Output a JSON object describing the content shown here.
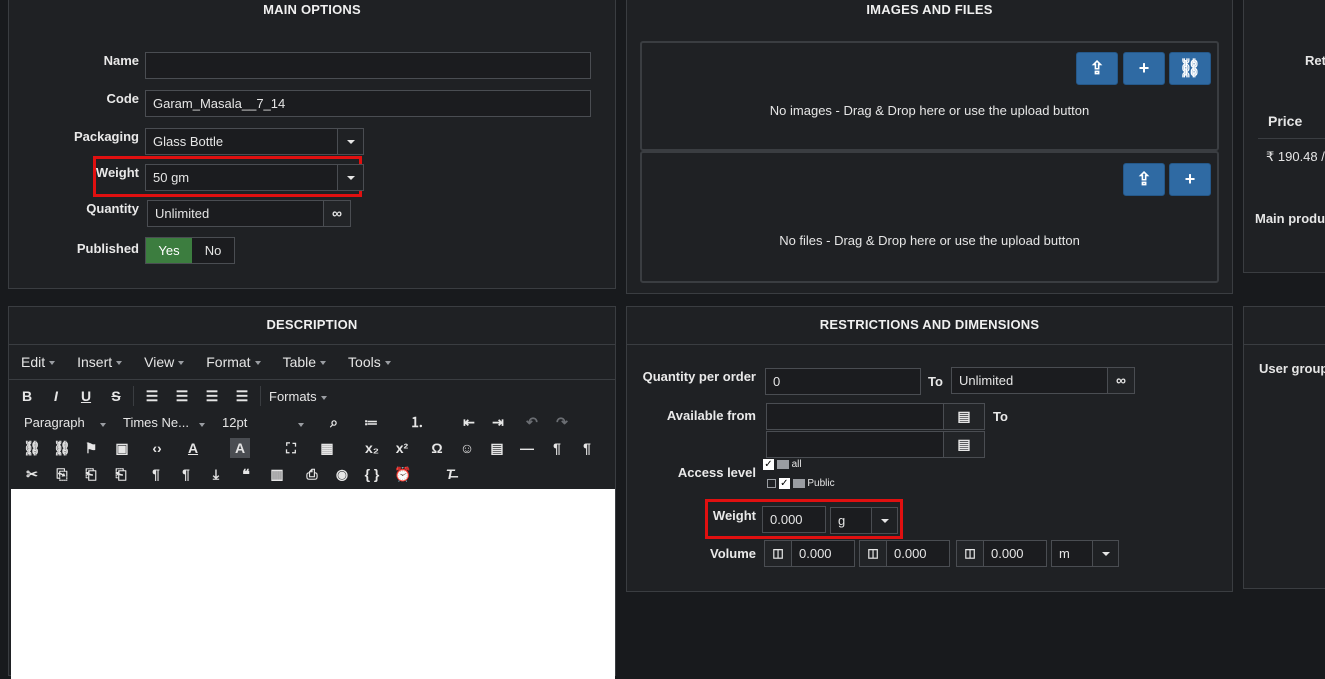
{
  "main_options": {
    "title": "MAIN OPTIONS",
    "name_label": "Name",
    "name_value": "",
    "code_label": "Code",
    "code_value": "Garam_Masala__7_14",
    "packaging_label": "Packaging",
    "packaging_value": "Glass Bottle",
    "weight_label": "Weight",
    "weight_value": "50 gm",
    "quantity_label": "Quantity",
    "quantity_value": "Unlimited",
    "published_label": "Published",
    "published_yes": "Yes",
    "published_no": "No"
  },
  "images_files": {
    "title": "IMAGES AND FILES",
    "no_images": "No images - Drag & Drop here or use the upload button",
    "no_files": "No files - Drag & Drop here or use the upload button"
  },
  "right_panel": {
    "ret_label": "Ret",
    "price_header": "Price",
    "price_value": "₹ 190.48 /",
    "main_product_label": "Main produ",
    "user_group_label": "User group"
  },
  "description": {
    "title": "DESCRIPTION",
    "menu": [
      "Edit",
      "Insert",
      "View",
      "Format",
      "Table",
      "Tools"
    ],
    "formats_label": "Formats",
    "block_format": "Paragraph",
    "font_family": "Times Ne...",
    "font_size": "12pt"
  },
  "restrictions": {
    "title": "RESTRICTIONS AND DIMENSIONS",
    "qty_per_order_label": "Quantity per order",
    "qty_min": "0",
    "to_label": "To",
    "qty_max": "Unlimited",
    "available_from_label": "Available from",
    "available_from": "",
    "available_to": "",
    "access_level_label": "Access level",
    "access_all": "all",
    "access_public": "Public",
    "weight_label": "Weight",
    "weight_value": "0.000",
    "weight_unit": "g",
    "volume_label": "Volume",
    "vol_l": "0.000",
    "vol_w": "0.000",
    "vol_h": "0.000",
    "vol_unit": "m"
  },
  "colors": {
    "accent_blue": "#2f6aa3",
    "toggle_green": "#3c7d3f",
    "highlight_red": "#e01010"
  }
}
